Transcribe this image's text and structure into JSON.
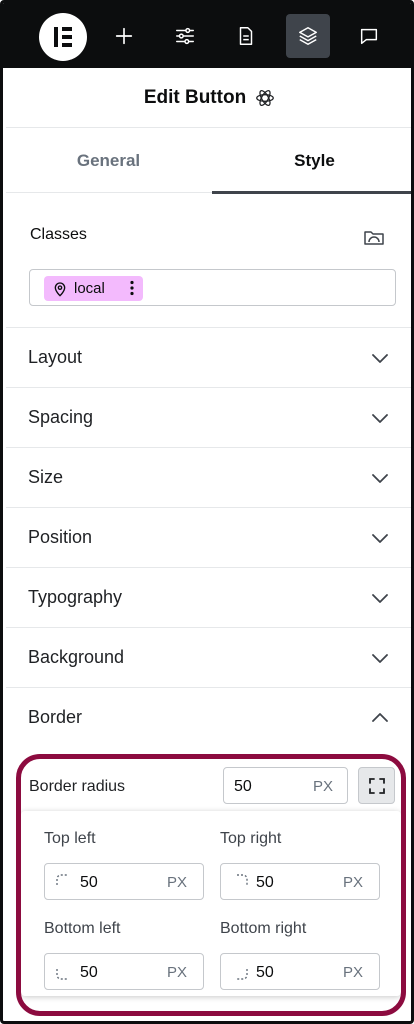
{
  "toolbar": {
    "icons": [
      "elementor-logo-icon",
      "add-icon",
      "settings-sliders-icon",
      "page-icon",
      "layers-icon",
      "comments-icon"
    ],
    "active": "layers-icon"
  },
  "header": {
    "title": "Edit Button",
    "icon": "atom-icon"
  },
  "tabs": [
    {
      "label": "General",
      "active": false
    },
    {
      "label": "Style",
      "active": true
    }
  ],
  "classes": {
    "label": "Classes",
    "chip": {
      "label": "local",
      "color": "#f3bafd"
    }
  },
  "sections": [
    {
      "label": "Layout",
      "expanded": false
    },
    {
      "label": "Spacing",
      "expanded": false
    },
    {
      "label": "Size",
      "expanded": false
    },
    {
      "label": "Position",
      "expanded": false
    },
    {
      "label": "Typography",
      "expanded": false
    },
    {
      "label": "Background",
      "expanded": false
    },
    {
      "label": "Border",
      "expanded": true
    }
  ],
  "border": {
    "radius": {
      "label": "Border radius",
      "value": "50",
      "unit": "PX",
      "corners": {
        "top_left": {
          "label": "Top left",
          "value": "50",
          "unit": "PX"
        },
        "top_right": {
          "label": "Top right",
          "value": "50",
          "unit": "PX"
        },
        "bottom_left": {
          "label": "Bottom left",
          "value": "50",
          "unit": "PX"
        },
        "bottom_right": {
          "label": "Bottom right",
          "value": "50",
          "unit": "PX"
        }
      }
    }
  },
  "colors": {
    "toolbar": "#0c0d0e",
    "highlight": "#8c0b3f",
    "chip": "#f3bafd"
  }
}
